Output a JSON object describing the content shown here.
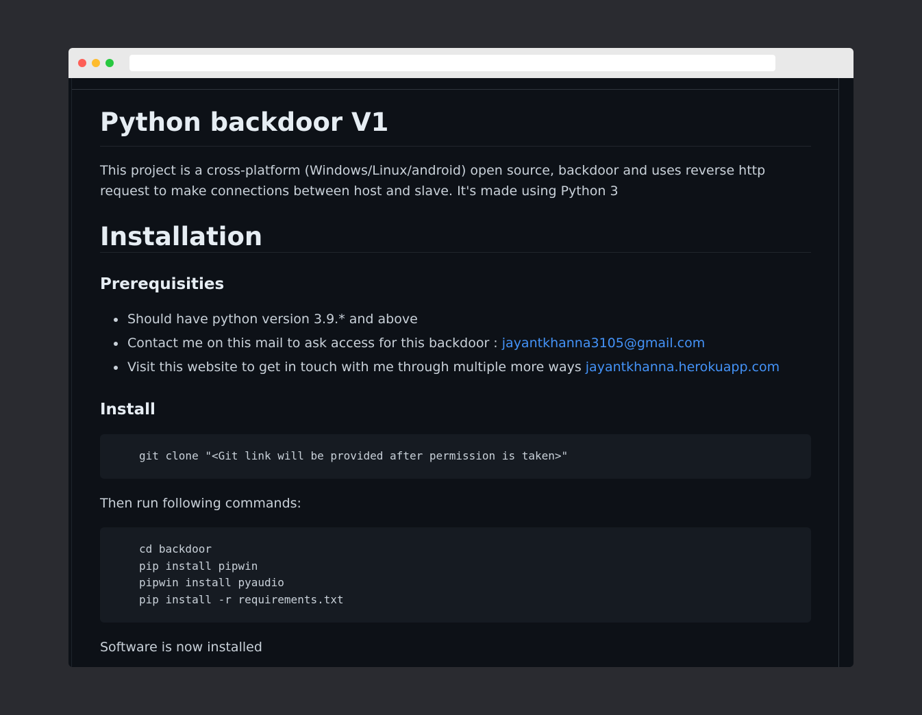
{
  "readme": {
    "title": "Python backdoor V1",
    "description": "This project is a cross-platform (Windows/Linux/android) open source, backdoor and uses reverse http request to make connections between host and slave. It's made using Python 3",
    "installation_heading": "Installation",
    "prerequisites_heading": "Prerequisities",
    "prerequisites": [
      {
        "text": "Should have python version 3.9.* and above"
      },
      {
        "text": "Contact me on this mail to ask access for this backdoor : ",
        "link": "jayantkhanna3105@gmail.com"
      },
      {
        "text": "Visit this website to get in touch with me through multiple more ways ",
        "link": "jayantkhanna.herokuapp.com"
      }
    ],
    "install_heading": "Install",
    "install_code": "git clone \"<Git link will be provided after permission is taken>\"",
    "then_text": "Then run following commands:",
    "commands_code": "cd backdoor\npip install pipwin\npipwin install pyaudio\npip install -r requirements.txt",
    "installed_text": "Software is now installed"
  },
  "colors": {
    "page_background": "#0d1117",
    "link": "#4493f8",
    "code_background": "#161b22",
    "outer_background": "#2a2b30"
  }
}
